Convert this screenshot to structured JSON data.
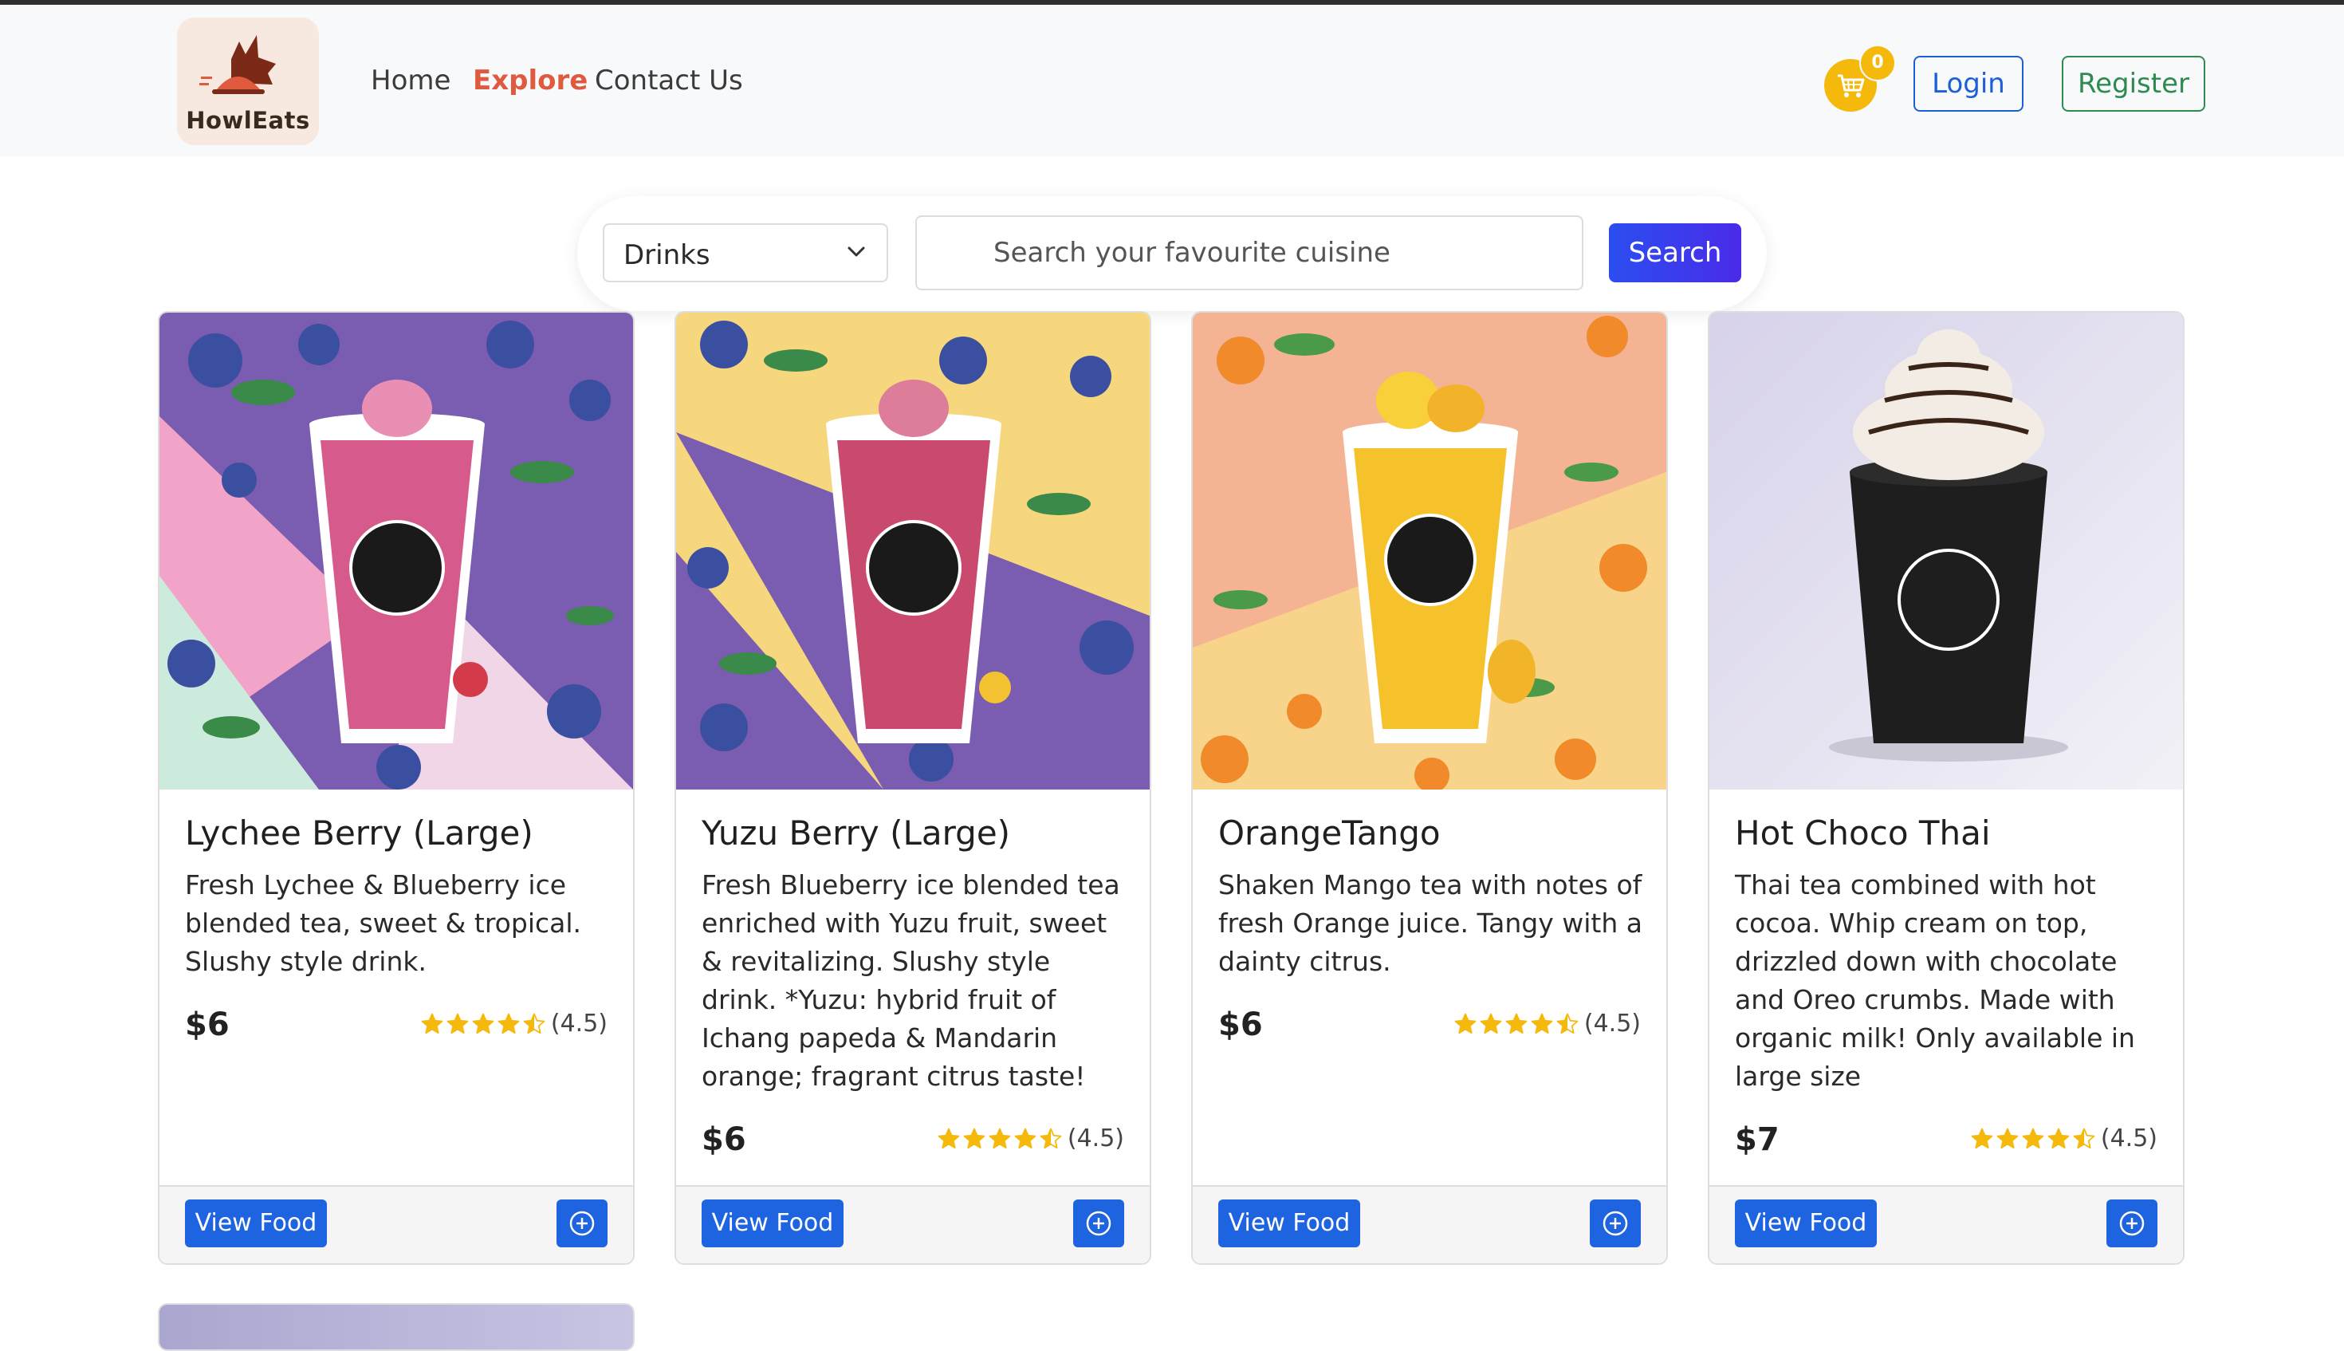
{
  "brand": {
    "name": "HowlEats",
    "colors": {
      "accent": "#e05a3f",
      "primary": "#1e63e0",
      "cart": "#f5b90c"
    }
  },
  "nav": {
    "links": [
      {
        "label": "Home",
        "active": false
      },
      {
        "label": "Explore",
        "active": true
      },
      {
        "label": "Contact Us",
        "active": false
      }
    ],
    "cart_count": "0",
    "login_label": "Login",
    "register_label": "Register"
  },
  "search": {
    "category": "Drinks",
    "placeholder": "Search your favourite cuisine",
    "button_label": "Search"
  },
  "cards": [
    {
      "title": "Lychee Berry (Large)",
      "description": "Fresh Lychee & Blueberry ice blended tea, sweet & tropical. Slushy style drink.",
      "price": "$6",
      "rating_text": "(4.5)",
      "rating": 4.5,
      "view_label": "View Food"
    },
    {
      "title": "Yuzu Berry (Large)",
      "description": "Fresh Blueberry ice blended tea enriched with Yuzu fruit, sweet & revitalizing. Slushy style drink. *Yuzu: hybrid fruit of Ichang papeda & Mandarin orange; fragrant citrus taste!",
      "price": "$6",
      "rating_text": "(4.5)",
      "rating": 4.5,
      "view_label": "View Food"
    },
    {
      "title": "OrangeTango",
      "description": "Shaken Mango tea with notes of fresh Orange juice. Tangy with a dainty citrus.",
      "price": "$6",
      "rating_text": "(4.5)",
      "rating": 4.5,
      "view_label": "View Food"
    },
    {
      "title": "Hot Choco Thai",
      "description": "Thai tea combined with hot cocoa. Whip cream on top, drizzled down with chocolate and Oreo crumbs. Made with organic milk! Only available in large size",
      "price": "$7",
      "rating_text": "(4.5)",
      "rating": 4.5,
      "view_label": "View Food"
    }
  ],
  "icons": [
    "logo-icon",
    "cart-icon",
    "chevron-down-icon",
    "star-icon",
    "plus-circle-icon"
  ]
}
